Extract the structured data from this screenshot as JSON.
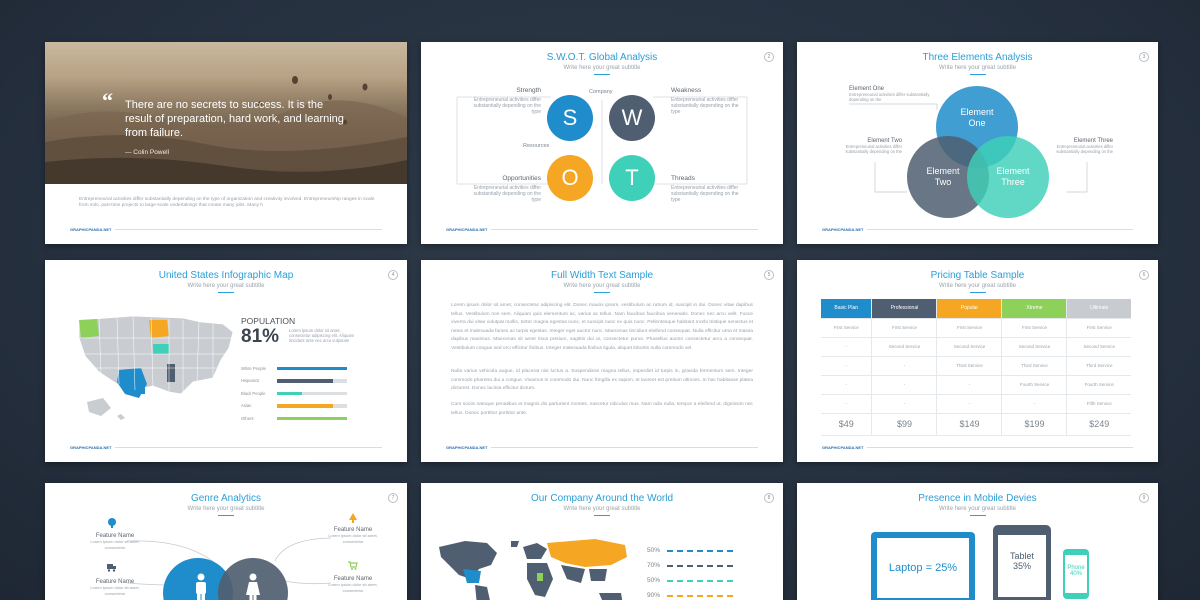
{
  "brand": "GRAPHICPANDA.NET",
  "colors": {
    "blue": "#1f8dcb",
    "dark": "#4f5e70",
    "orange": "#f5a623",
    "teal": "#3ed0b8",
    "green": "#8ed15a",
    "gray": "#c8ccd0",
    "accent_title": "#2a9fd6"
  },
  "slide1": {
    "quote": "There are no secrets to success. It is the result of preparation, hard work, and learning from failure.",
    "author": "— Colin Powell",
    "body": "Entrepreneurial activities differ substantially depending on the type of organization and creativity involved. Entrepreneurship ranges in scale from solo, part-time projects to large-scale undertakings that create many jobs. Many h"
  },
  "slide2": {
    "title": "S.W.O.T. Global Analysis",
    "subtitle": "Write here your great subtitle",
    "number": "2",
    "company": "Company",
    "resources": "Resources",
    "desc": "Entrepreneurial activities differ substantially depending on the type",
    "items": [
      {
        "letter": "S",
        "heading": "Strength"
      },
      {
        "letter": "W",
        "heading": "Weakness"
      },
      {
        "letter": "O",
        "heading": "Opportunities"
      },
      {
        "letter": "T",
        "heading": "Threads"
      }
    ]
  },
  "slide3": {
    "title": "Three Elements Analysis",
    "subtitle": "Write here your great subtitle",
    "number": "3",
    "desc": "Entrepreneurial activities differ substantially depending on the",
    "labels": [
      "Element One",
      "Element Two",
      "Element Three"
    ],
    "circle_one": [
      "Element",
      "One"
    ],
    "circle_two": [
      "Element",
      "Two"
    ],
    "circle_three": [
      "Element",
      "Three"
    ]
  },
  "slide4": {
    "title": "United States Infographic Map",
    "subtitle": "Write here your great subtitle",
    "number": "4",
    "pop_label": "POPULATION",
    "pop_value": "81%",
    "pop_desc": "Lorem ipsum dolor sit amet, consectetur adipiscing elit. Aliquam tincidunt ante nec arcu vulputate",
    "bars": [
      {
        "label": "White People",
        "fraction": 1.0
      },
      {
        "label": "Hispanics",
        "fraction": 0.8
      },
      {
        "label": "Black People",
        "fraction": 0.35
      },
      {
        "label": "Asian",
        "fraction": 0.8
      },
      {
        "label": "Others",
        "fraction": 1.0
      }
    ]
  },
  "slide5": {
    "title": "Full Width Text Sample",
    "subtitle": "Write here your great subtitle",
    "number": "5",
    "p1": "Lorem ipsum dolor sit amet, consectetur adipiscing elit. Donec mauris ipsum, vestibulum ac rutrum id, suscipit in dui. Donec vitae dapibus tellus. Vestibulum non sem. Aliquam quis elementum ac, varius ac tellus. Nam faucibus faucibus venenatis. Donec nec arcu velit. Fusce viverra dui vitae volutpat mollis, tortor magna egestas nunc, et suscipit nunc ex quis nunc. Pellentesque habitant morbi tristique senectus et netus et malesuada fames ac turpis egestas. Integer eget auctor nunc. Maecenas tincidunt eleifend consequat. Nulla efficitur urna et massa dapibus maximus. Maecenas sit amet risus pretium, sagittis dui ut, consectetur purus. Phasellus auctor consectetur arcu a consequat. Vestibulum congue sed orci efficitur finibus. Integer malesuada finibus ligula, aliquet lobortis nulla commodo vel.",
    "p2": "Nulla varius vehicula augue, id placerat nisi luctus a. Suspendisse magna tellus, imperdiet id turpis in, gravida fermentum sem. Integer commodo pharetra dui a congue. Vivamus in commodo dui. Nunc fringilla ex sapien, et laoreet est pretium ultricies. In hac habitasse platea dictumst. Donec lacinia efficitur dictum.",
    "p3": "Cum sociis natoque penatibus et magnis dis parturient montes, nascetur ridiculus mus. Nam odio nulla, tempor a eleifend ut, dignissim nec tellus. Donec porttitor porttitor ante."
  },
  "slide6": {
    "title": "Pricing Table Sample",
    "subtitle": "Write here your great subtitle",
    "number": "6",
    "plans": [
      {
        "name": "Basic Plan",
        "color": "#1f8dcb",
        "price": "$49"
      },
      {
        "name": "Professional",
        "color": "#4f5e70",
        "price": "$99"
      },
      {
        "name": "Popular",
        "color": "#f5a623",
        "price": "$149"
      },
      {
        "name": "Xtreme",
        "color": "#8ed15a",
        "price": "$199"
      },
      {
        "name": "Ultimate",
        "color": "#c8ccd0",
        "price": "$249"
      }
    ],
    "rows": [
      [
        "First Service",
        "First Service",
        "First Service",
        "First Service",
        "First Service"
      ],
      [
        "-",
        "Second Service",
        "Second Service",
        "Second Service",
        "Second Service"
      ],
      [
        "-",
        "-",
        "Third Service",
        "Third Service",
        "Third Service"
      ],
      [
        "-",
        "-",
        "-",
        "Fourth Service",
        "Fourth Service"
      ],
      [
        "-",
        "-",
        "-",
        "-",
        "Fifth Service"
      ]
    ]
  },
  "slide7": {
    "title": "Genre Analytics",
    "subtitle": "Write here your great subtitle",
    "number": "7",
    "feature": "Feature Name",
    "feature_desc": "Lorem ipsum dolor sit amet, consectetur"
  },
  "slide8": {
    "title": "Our Company Around the World",
    "subtitle": "Write here your great subtitle",
    "number": "8",
    "stats": [
      {
        "label": "50%",
        "color": "#1f8dcb"
      },
      {
        "label": "70%",
        "color": "#4f5e70"
      },
      {
        "label": "50%",
        "color": "#3ed0b8"
      },
      {
        "label": "90%",
        "color": "#f5a623"
      }
    ]
  },
  "slide9": {
    "title": "Presence in Mobile Devies",
    "subtitle": "Write here your great subtitle",
    "number": "9",
    "laptop": "Laptop = 25%",
    "tablet": "Tablet",
    "tablet_pct": "35%",
    "phone": "Phone",
    "phone_pct": "40%"
  }
}
